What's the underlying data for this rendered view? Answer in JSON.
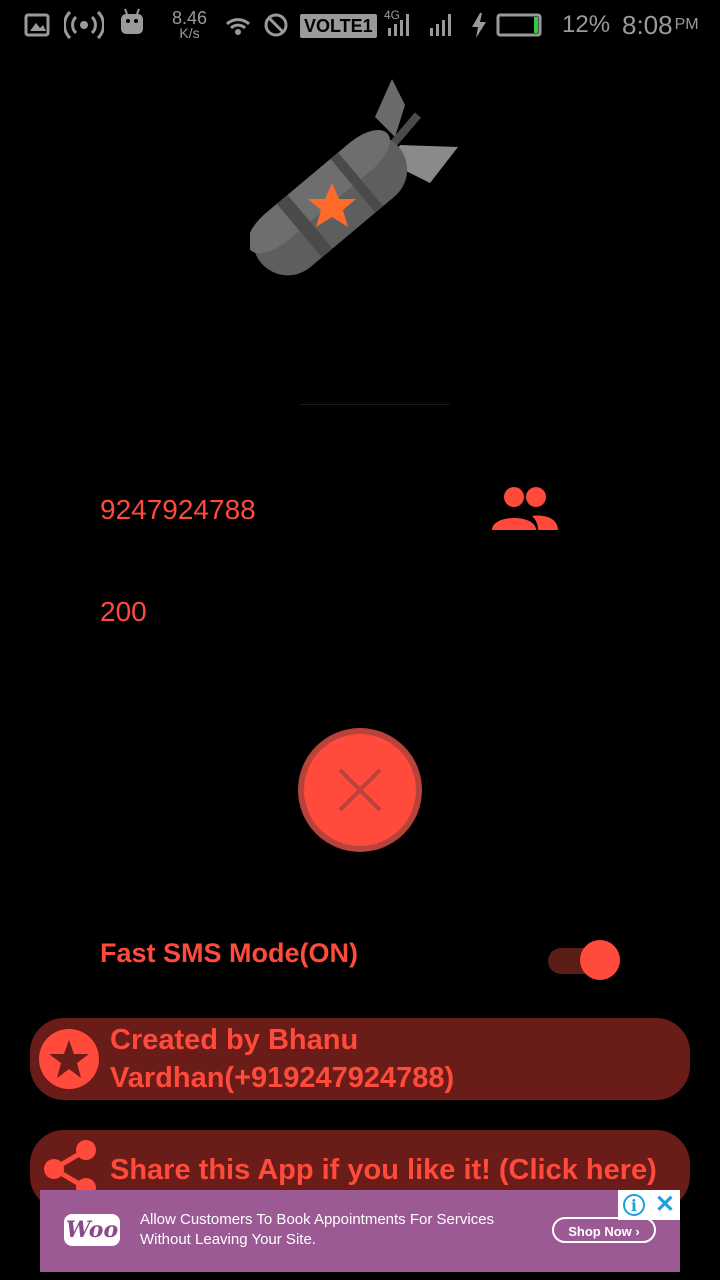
{
  "status_bar": {
    "net_speed_value": "8.46",
    "net_speed_unit": "K/s",
    "volte": "VOLTE1",
    "network": "4G",
    "battery_percent": "12%",
    "time": "8:08",
    "am_pm": "PM"
  },
  "form": {
    "phone_number": "9247924788",
    "message_count": "200"
  },
  "settings": {
    "fast_sms_label": "Fast SMS Mode(ON)",
    "fast_sms_on": true
  },
  "credit": {
    "text": "Created by Bhanu Vardhan(+919247924788)"
  },
  "share": {
    "text": "Share this App if you like it! (Click here)"
  },
  "ad": {
    "logo": "Woo",
    "copy": "Allow Customers To Book Appointments For Services Without Leaving Your Site.",
    "cta": "Shop Now"
  },
  "colors": {
    "accent": "#ff4a3c",
    "pill_bg": "#6a1d18",
    "background": "#000000",
    "ad_bg": "#9c5a94"
  },
  "icons": [
    "gallery-icon",
    "hotspot-icon",
    "android-icon",
    "wifi-icon",
    "dnd-icon",
    "signal-icon",
    "charging-icon",
    "battery-icon",
    "bomb-icon",
    "contacts-icon",
    "close-icon",
    "star-icon",
    "share-icon",
    "info-icon"
  ]
}
